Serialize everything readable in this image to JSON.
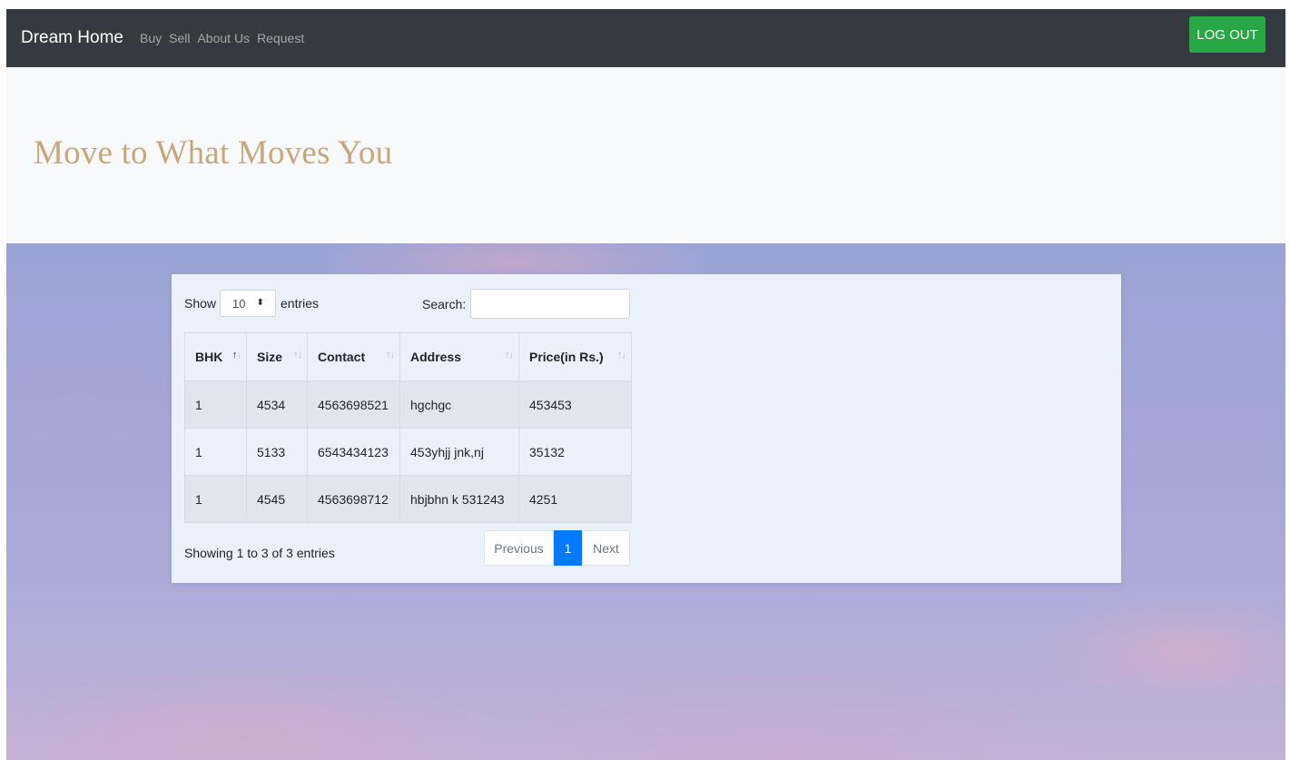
{
  "navbar": {
    "brand": "Dream Home",
    "links": [
      "Buy",
      "Sell",
      "About Us",
      "Request"
    ],
    "logout_label": "LOG OUT"
  },
  "hero": {
    "title": "Move to What Moves You"
  },
  "table_controls": {
    "show_label": "Show",
    "entries_value": "10",
    "entries_label": "entries",
    "search_label": "Search:",
    "search_value": ""
  },
  "table": {
    "columns": [
      "BHK",
      "Size",
      "Contact",
      "Address",
      "Price(in Rs.)"
    ],
    "sorted_column": "BHK",
    "rows": [
      [
        "1",
        "4534",
        "4563698521",
        "hgchgc",
        "453453"
      ],
      [
        "1",
        "5133",
        "6543434123",
        "453yhjj jnk,nj",
        "35132"
      ],
      [
        "1",
        "4545",
        "4563698712",
        "hbjbhn k 531243",
        "4251"
      ]
    ]
  },
  "footer": {
    "info": "Showing 1 to 3 of 3 entries",
    "pagination": {
      "previous": "Previous",
      "current_page": "1",
      "next": "Next"
    }
  },
  "colors": {
    "navbar_bg": "#343a40",
    "logout_bg": "#28a745",
    "hero_title": "#c8a87a",
    "page_active": "#007bff"
  },
  "icons": {
    "sort": "sort-arrows-icon",
    "select_caret": "updown-caret-icon"
  }
}
